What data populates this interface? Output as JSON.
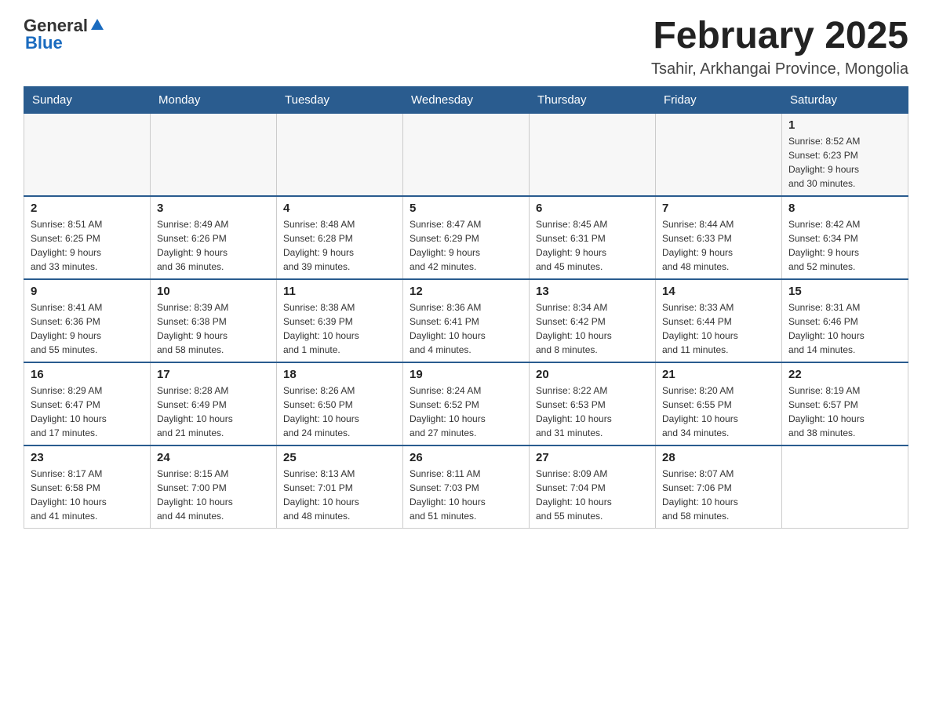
{
  "header": {
    "logo": {
      "general": "General",
      "arrow": "▶",
      "blue": "Blue"
    },
    "title": "February 2025",
    "subtitle": "Tsahir, Arkhangai Province, Mongolia"
  },
  "calendar": {
    "days_of_week": [
      "Sunday",
      "Monday",
      "Tuesday",
      "Wednesday",
      "Thursday",
      "Friday",
      "Saturday"
    ],
    "weeks": [
      [
        {
          "day": "",
          "info": ""
        },
        {
          "day": "",
          "info": ""
        },
        {
          "day": "",
          "info": ""
        },
        {
          "day": "",
          "info": ""
        },
        {
          "day": "",
          "info": ""
        },
        {
          "day": "",
          "info": ""
        },
        {
          "day": "1",
          "info": "Sunrise: 8:52 AM\nSunset: 6:23 PM\nDaylight: 9 hours\nand 30 minutes."
        }
      ],
      [
        {
          "day": "2",
          "info": "Sunrise: 8:51 AM\nSunset: 6:25 PM\nDaylight: 9 hours\nand 33 minutes."
        },
        {
          "day": "3",
          "info": "Sunrise: 8:49 AM\nSunset: 6:26 PM\nDaylight: 9 hours\nand 36 minutes."
        },
        {
          "day": "4",
          "info": "Sunrise: 8:48 AM\nSunset: 6:28 PM\nDaylight: 9 hours\nand 39 minutes."
        },
        {
          "day": "5",
          "info": "Sunrise: 8:47 AM\nSunset: 6:29 PM\nDaylight: 9 hours\nand 42 minutes."
        },
        {
          "day": "6",
          "info": "Sunrise: 8:45 AM\nSunset: 6:31 PM\nDaylight: 9 hours\nand 45 minutes."
        },
        {
          "day": "7",
          "info": "Sunrise: 8:44 AM\nSunset: 6:33 PM\nDaylight: 9 hours\nand 48 minutes."
        },
        {
          "day": "8",
          "info": "Sunrise: 8:42 AM\nSunset: 6:34 PM\nDaylight: 9 hours\nand 52 minutes."
        }
      ],
      [
        {
          "day": "9",
          "info": "Sunrise: 8:41 AM\nSunset: 6:36 PM\nDaylight: 9 hours\nand 55 minutes."
        },
        {
          "day": "10",
          "info": "Sunrise: 8:39 AM\nSunset: 6:38 PM\nDaylight: 9 hours\nand 58 minutes."
        },
        {
          "day": "11",
          "info": "Sunrise: 8:38 AM\nSunset: 6:39 PM\nDaylight: 10 hours\nand 1 minute."
        },
        {
          "day": "12",
          "info": "Sunrise: 8:36 AM\nSunset: 6:41 PM\nDaylight: 10 hours\nand 4 minutes."
        },
        {
          "day": "13",
          "info": "Sunrise: 8:34 AM\nSunset: 6:42 PM\nDaylight: 10 hours\nand 8 minutes."
        },
        {
          "day": "14",
          "info": "Sunrise: 8:33 AM\nSunset: 6:44 PM\nDaylight: 10 hours\nand 11 minutes."
        },
        {
          "day": "15",
          "info": "Sunrise: 8:31 AM\nSunset: 6:46 PM\nDaylight: 10 hours\nand 14 minutes."
        }
      ],
      [
        {
          "day": "16",
          "info": "Sunrise: 8:29 AM\nSunset: 6:47 PM\nDaylight: 10 hours\nand 17 minutes."
        },
        {
          "day": "17",
          "info": "Sunrise: 8:28 AM\nSunset: 6:49 PM\nDaylight: 10 hours\nand 21 minutes."
        },
        {
          "day": "18",
          "info": "Sunrise: 8:26 AM\nSunset: 6:50 PM\nDaylight: 10 hours\nand 24 minutes."
        },
        {
          "day": "19",
          "info": "Sunrise: 8:24 AM\nSunset: 6:52 PM\nDaylight: 10 hours\nand 27 minutes."
        },
        {
          "day": "20",
          "info": "Sunrise: 8:22 AM\nSunset: 6:53 PM\nDaylight: 10 hours\nand 31 minutes."
        },
        {
          "day": "21",
          "info": "Sunrise: 8:20 AM\nSunset: 6:55 PM\nDaylight: 10 hours\nand 34 minutes."
        },
        {
          "day": "22",
          "info": "Sunrise: 8:19 AM\nSunset: 6:57 PM\nDaylight: 10 hours\nand 38 minutes."
        }
      ],
      [
        {
          "day": "23",
          "info": "Sunrise: 8:17 AM\nSunset: 6:58 PM\nDaylight: 10 hours\nand 41 minutes."
        },
        {
          "day": "24",
          "info": "Sunrise: 8:15 AM\nSunset: 7:00 PM\nDaylight: 10 hours\nand 44 minutes."
        },
        {
          "day": "25",
          "info": "Sunrise: 8:13 AM\nSunset: 7:01 PM\nDaylight: 10 hours\nand 48 minutes."
        },
        {
          "day": "26",
          "info": "Sunrise: 8:11 AM\nSunset: 7:03 PM\nDaylight: 10 hours\nand 51 minutes."
        },
        {
          "day": "27",
          "info": "Sunrise: 8:09 AM\nSunset: 7:04 PM\nDaylight: 10 hours\nand 55 minutes."
        },
        {
          "day": "28",
          "info": "Sunrise: 8:07 AM\nSunset: 7:06 PM\nDaylight: 10 hours\nand 58 minutes."
        },
        {
          "day": "",
          "info": ""
        }
      ]
    ]
  }
}
